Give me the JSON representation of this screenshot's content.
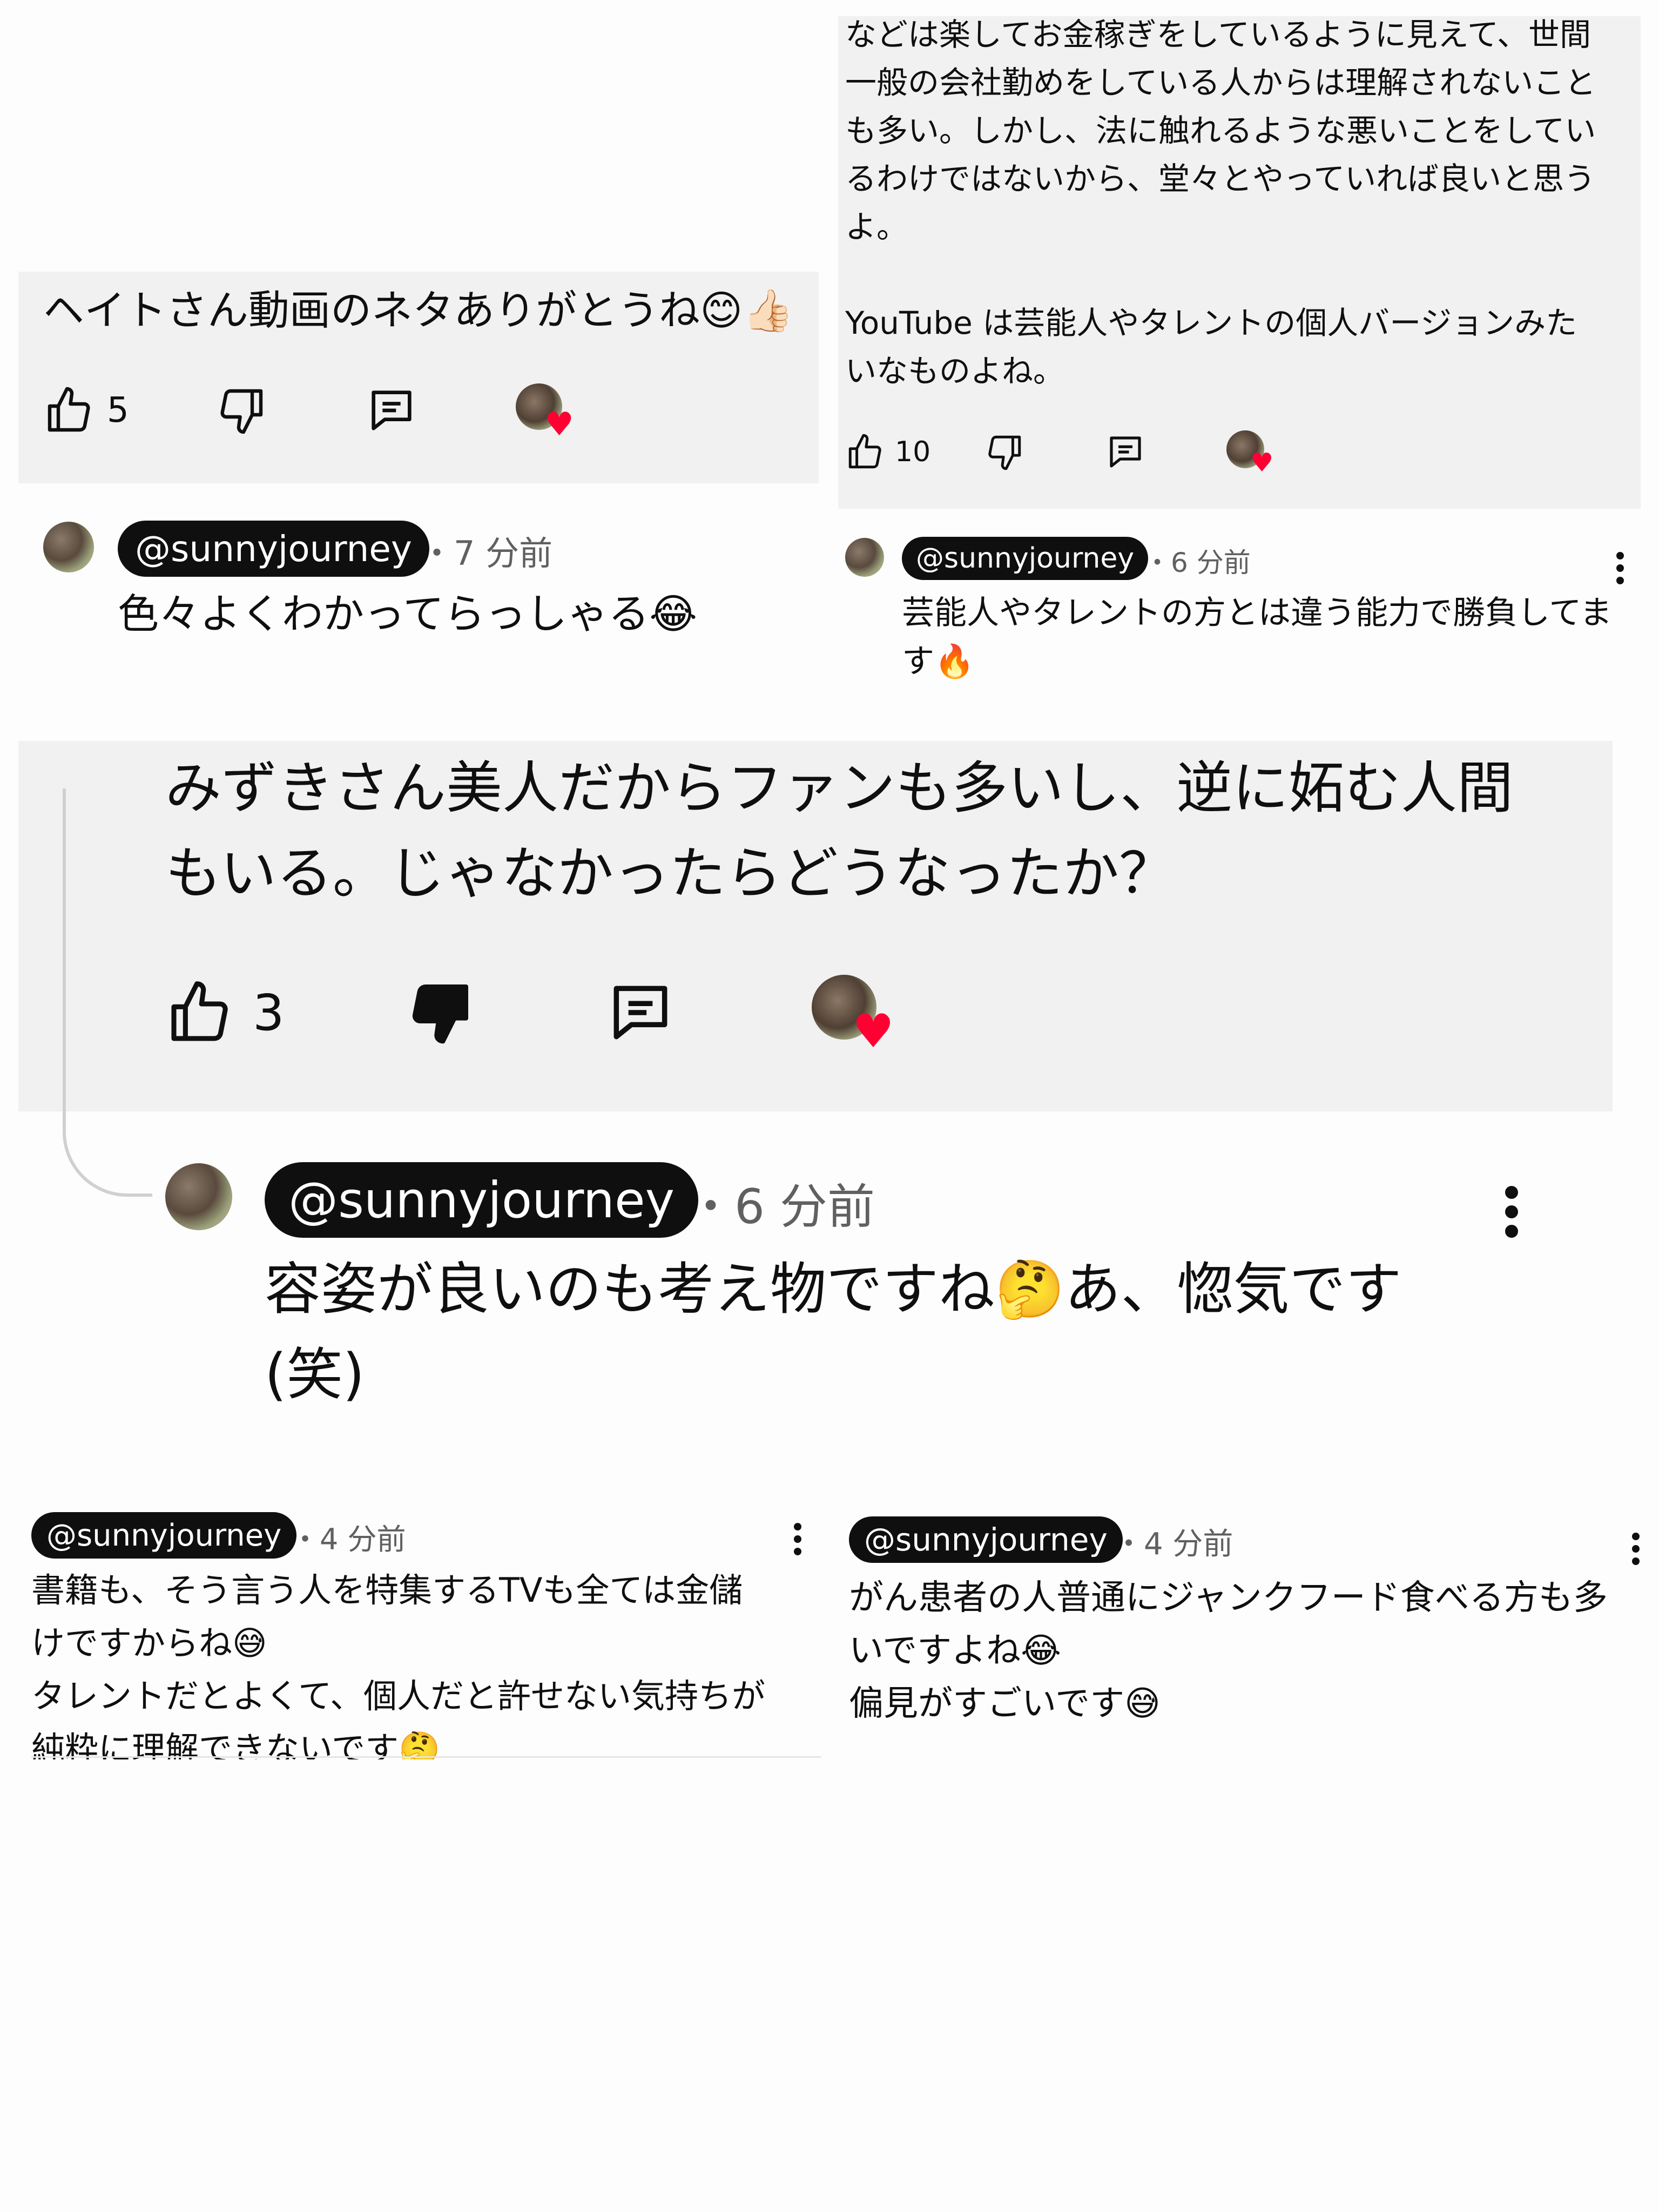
{
  "screenshot_1": {
    "comment_text": "ヘイトさん動画のネタありがとうね😊👍🏻",
    "like_count": "5",
    "reply": {
      "handle": "@sunnyjourney",
      "time": "・7 分前",
      "text": "色々よくわかってらっしゃる😂"
    }
  },
  "screenshot_2": {
    "comment_text": "などは楽してお金稼ぎをしているように見えて、世間\n一般の会社勤めをしている人からは理解されないこと\nも多い。しかし、法に触れるような悪いことをしてい\nるわけではないから、堂々とやっていれば良いと思う\nよ。\n\nYouTube は芸能人やタレントの個人バージョンみた\nいなものよね。",
    "like_count": "10",
    "reply": {
      "handle": "@sunnyjourney",
      "time": "・6 分前",
      "text": "芸能人やタレントの方とは違う能力で勝負してま\nす🔥"
    }
  },
  "screenshot_3": {
    "comment_text": "みずきさん美人だからファンも多いし、逆に妬む人間\nもいる。じゃなかったらどうなったか？",
    "like_count": "3",
    "reply": {
      "handle": "@sunnyjourney",
      "time": "・6 分前",
      "text": "容姿が良いのも考え物ですね🤔あ、惚気です\n(笑)"
    }
  },
  "screenshot_4": {
    "handle": "@sunnyjourney",
    "time": "・4 分前",
    "text": "書籍も、そう言う人を特集するTVも全ては金儲\nけですからね😅\nタレントだとよくて、個人だと許せない気持ちが\n純粋に理解できないです🤔"
  },
  "screenshot_5": {
    "handle": "@sunnyjourney",
    "time": "・4 分前",
    "text": "がん患者の人普通にジャンクフード食べる方も多\nいですよね😂\n偏見がすごいです😅"
  },
  "icons": {
    "like": "thumbs-up-icon",
    "dislike": "thumbs-down-icon",
    "reply": "comment-icon",
    "creator_heart": "creator-heart-icon",
    "more": "more-vert-icon"
  },
  "colors": {
    "panel_bg": "#f1f1f1",
    "handle_bg": "#0f0f0f",
    "heart": "#ff0033",
    "meta_text": "#606060"
  }
}
